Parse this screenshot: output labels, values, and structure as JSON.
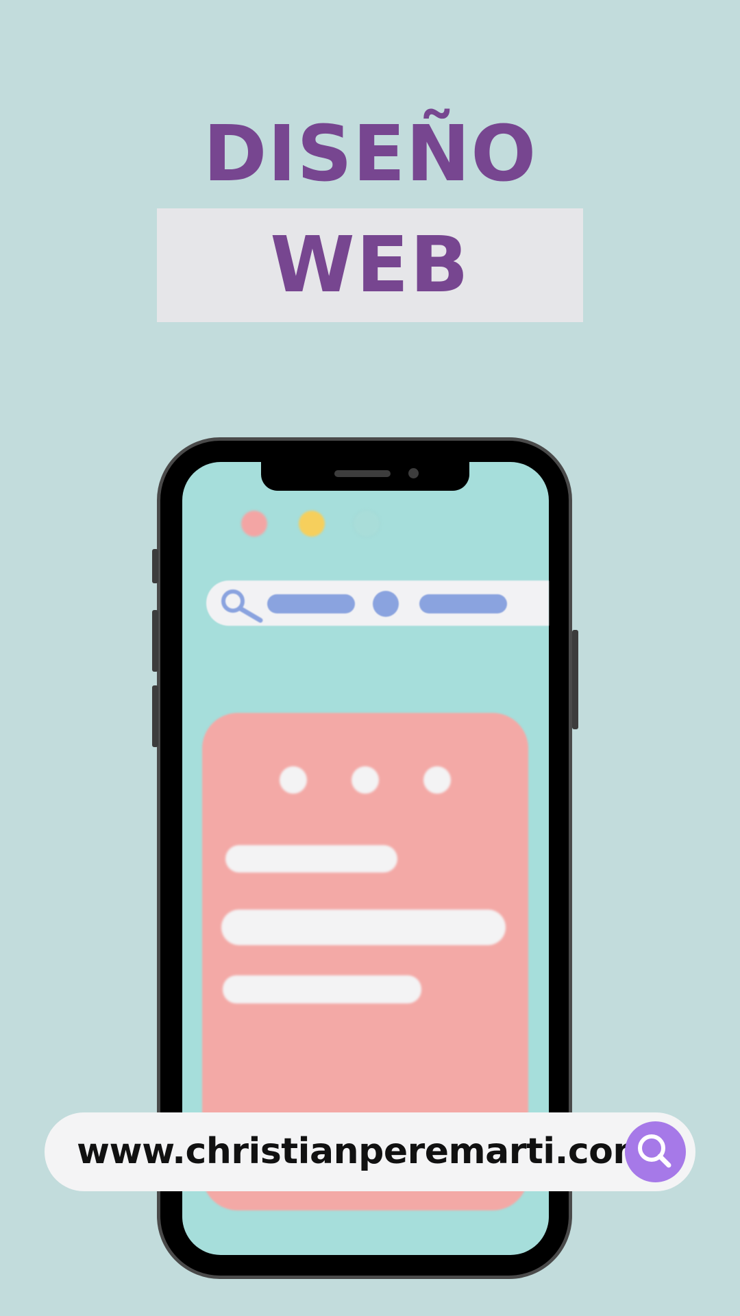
{
  "title": {
    "line1": "DISEÑO",
    "line2": "WEB"
  },
  "phone": {
    "window_dots": [
      {
        "icon": "red-dot",
        "color": "#f3a5a4"
      },
      {
        "icon": "yellow-dot",
        "color": "#f6cf5c"
      },
      {
        "icon": "teal-dot",
        "color": "#a9ddd9"
      }
    ],
    "search_icon": "search-icon",
    "accent_color": "#8aa3df",
    "card_color": "#f3a9a6"
  },
  "url_bar": {
    "url": "www.christianperemarti.com",
    "button_icon": "search-icon",
    "button_color": "#a679e8"
  },
  "colors": {
    "background": "#c2dcdc",
    "title": "#774690",
    "screen": "#a6dedb"
  }
}
